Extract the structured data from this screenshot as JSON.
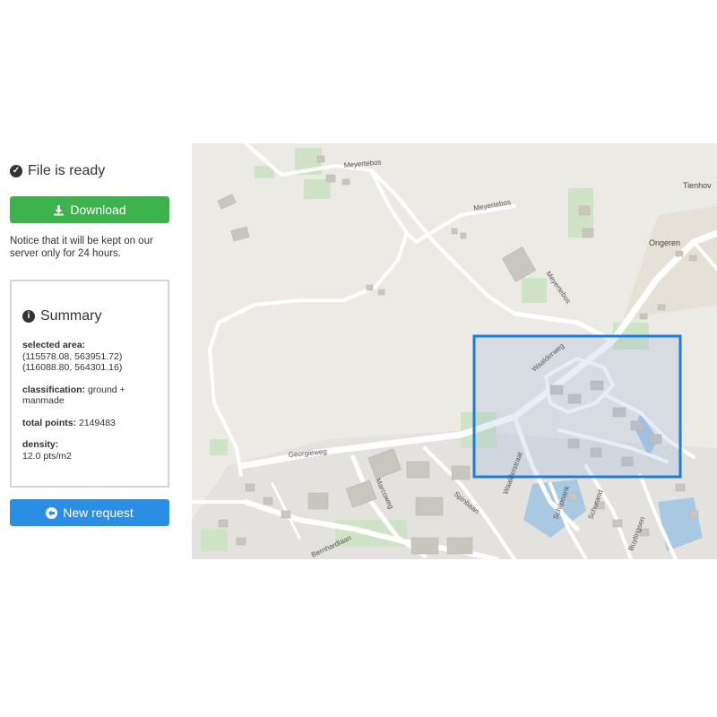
{
  "status": {
    "title": "File is ready"
  },
  "download": {
    "label": "Download"
  },
  "notice": {
    "text": "Notice that it will be kept on our server only for 24 hours."
  },
  "summary": {
    "title": "Summary",
    "selected_area_label": "selected area:",
    "selected_area_line1": "(115578.08, 563951.72)",
    "selected_area_line2": "(116088.80, 564301.16)",
    "classification_label": "classification:",
    "classification_value": "ground + manmade",
    "total_points_label": "total points:",
    "total_points_value": "2149483",
    "density_label": "density:",
    "density_value": "12.0 pts/m2"
  },
  "new_request": {
    "label": "New request"
  },
  "map": {
    "place_labels": {
      "tienhoven": "Tienhov",
      "ongeren": "Ongeren"
    },
    "street_labels": {
      "meyertebos_1": "Meyertebos",
      "meyertebos_2": "Meyertebos",
      "meyertebos_3": "Meyertebos",
      "georgieweg": "Georgieweg",
      "waalderweg": "Waalderweg",
      "marcoweg": "Marcoweg",
      "spinbaan": "Spinbaan",
      "bernhardlaan": "Bernhardlaan",
      "waalderstraat": "Waalderstraat",
      "schilpoank": "Schilpoank",
      "schurand": "Schurand",
      "buytingsen": "Buytingsen"
    },
    "colors": {
      "background": "#eceae4",
      "selection": "#1e7be0",
      "road": "#ffffff",
      "building": "#c9c6c0",
      "park": "#cfe4c4"
    }
  }
}
